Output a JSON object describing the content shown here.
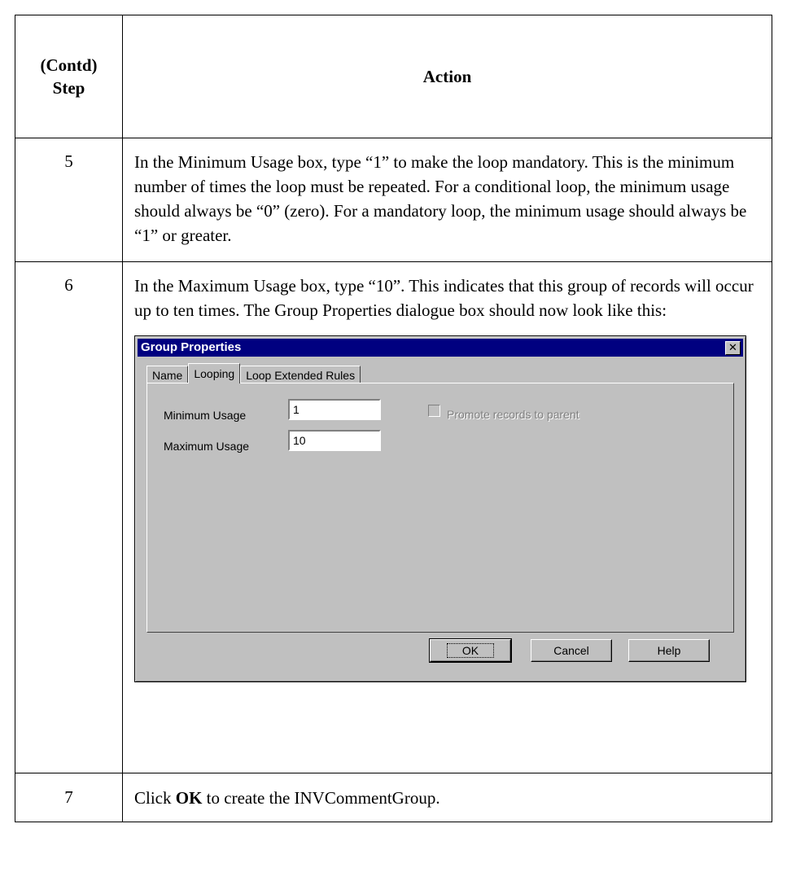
{
  "table": {
    "header_step_line1": "(Contd)",
    "header_step_line2": "Step",
    "header_action": "Action",
    "rows": [
      {
        "step": "5",
        "text": "In the Minimum Usage box, type “1” to make the loop mandatory. This is the minimum number of times the loop must be repeated. For a conditional loop, the minimum usage should always be “0” (zero). For a mandatory loop, the minimum usage should always be “1” or greater."
      },
      {
        "step": "6",
        "text": "In the Maximum Usage box, type “10”. This indicates that this group of records will occur up to ten times. The Group Properties dialogue box should now look like this:"
      },
      {
        "step": "7",
        "text_pre": "Click ",
        "text_bold": "OK",
        "text_post": " to create the INVCommentGroup."
      }
    ]
  },
  "dialog": {
    "title": "Group Properties",
    "close_glyph": "✕",
    "tabs": [
      "Name",
      "Looping",
      "Loop Extended Rules"
    ],
    "active_tab": "Looping",
    "minimum_usage_label": "Minimum Usage",
    "minimum_usage_value": "1",
    "maximum_usage_label": "Maximum Usage",
    "maximum_usage_value": "10",
    "promote_label": "Promote records to parent",
    "promote_checked": false,
    "buttons": {
      "ok": "OK",
      "cancel": "Cancel",
      "help": "Help"
    }
  }
}
